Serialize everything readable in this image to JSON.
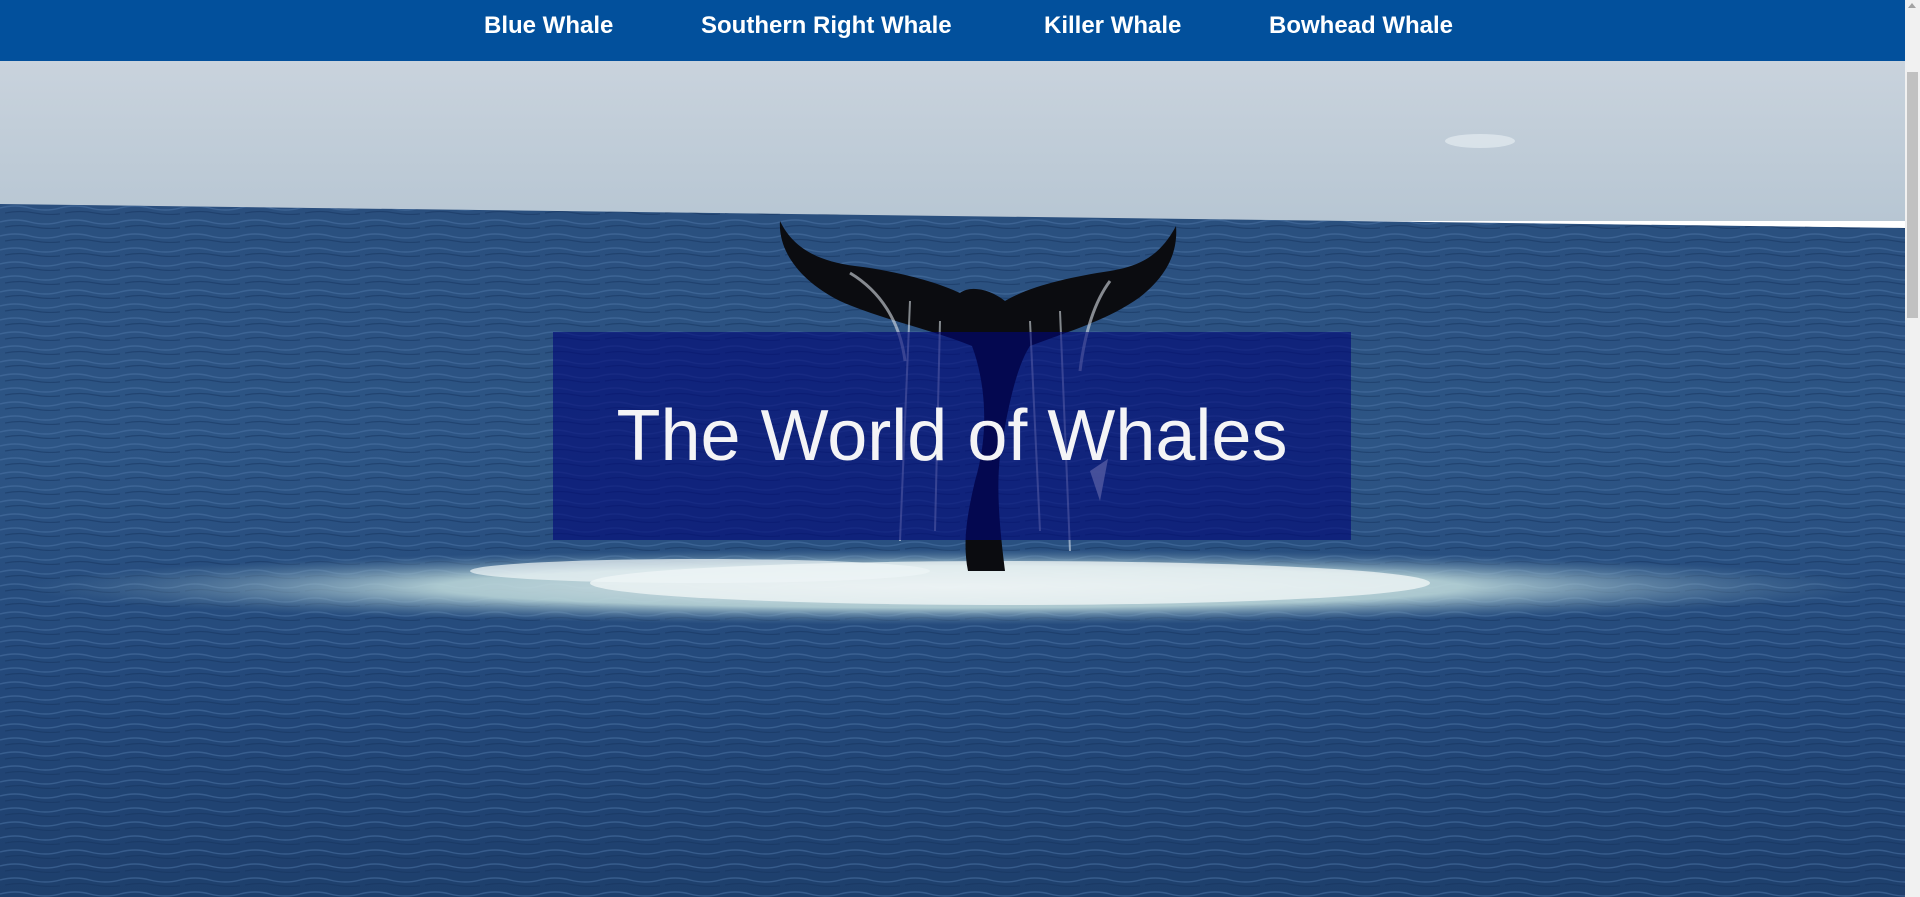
{
  "nav": {
    "items": [
      {
        "label": "Blue Whale"
      },
      {
        "label": "Southern Right Whale"
      },
      {
        "label": "Killer Whale"
      },
      {
        "label": "Bowhead Whale"
      }
    ],
    "background_color": "#02509c"
  },
  "hero": {
    "title": "The World of Whales",
    "image_subject": "humpback whale tail (fluke) above ocean surface",
    "overlay_color": "#00067a"
  }
}
